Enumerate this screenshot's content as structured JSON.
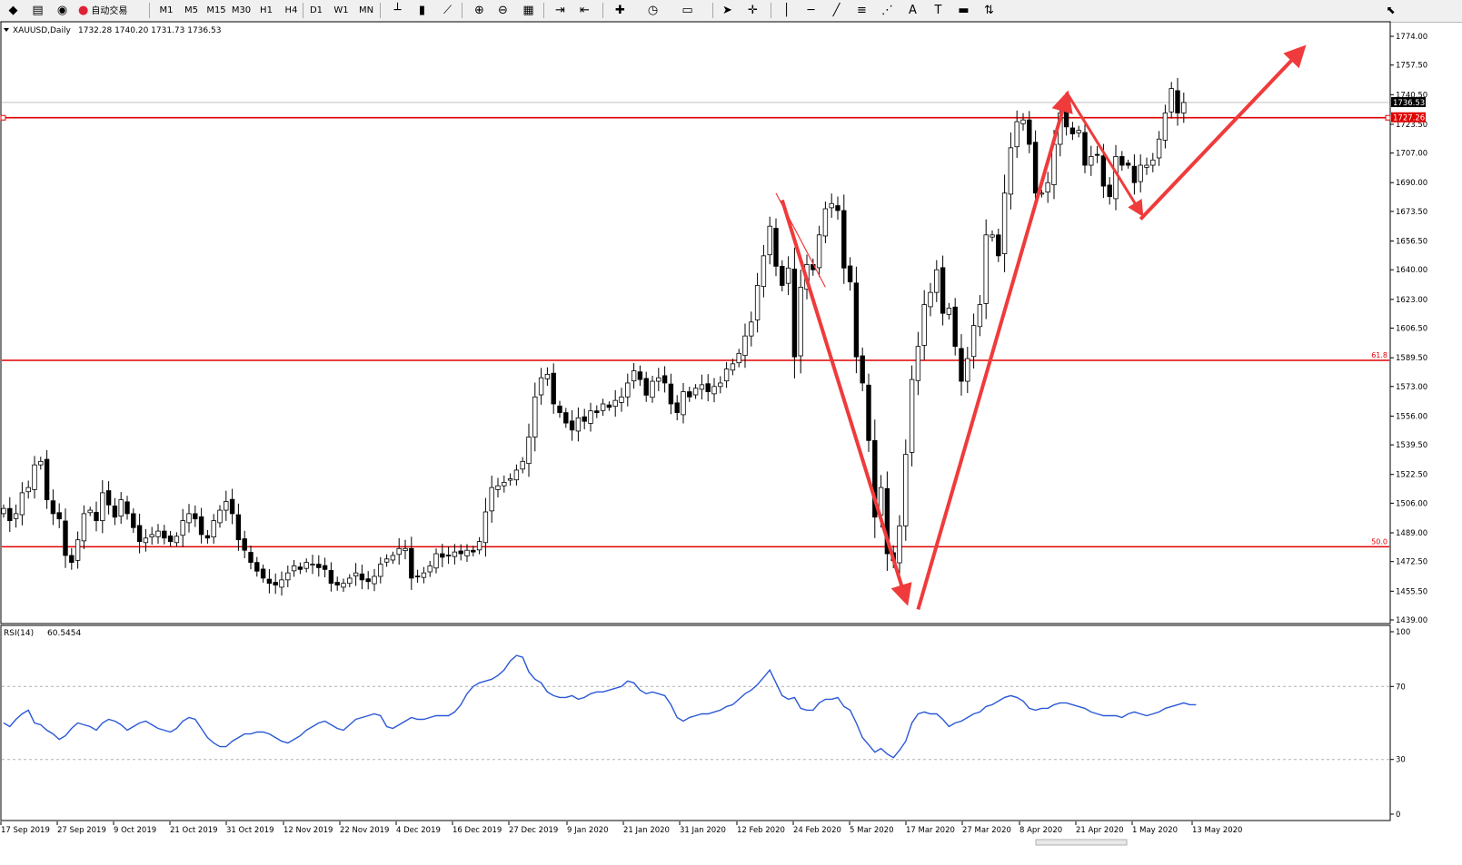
{
  "toolbar": {
    "auto_trading_label": "自动交易",
    "timeframes": [
      "M1",
      "M5",
      "M15",
      "M30",
      "H1",
      "H4",
      "D1",
      "W1",
      "MN"
    ],
    "icons": [
      "new-chart-icon",
      "profiles-icon",
      "market-watch-icon",
      "auto-trading-icon",
      "bar-chart-icon",
      "candlestick-icon",
      "line-chart-icon",
      "zoom-in-icon",
      "zoom-out-icon",
      "tile-windows-icon",
      "scroll-chart-icon",
      "chart-shift-icon",
      "indicators-icon",
      "periods-icon",
      "templates-icon",
      "cursor-icon",
      "crosshair-icon",
      "vertical-line-icon",
      "horizontal-line-icon",
      "trendline-icon",
      "equidistant-channel-icon",
      "fibonacci-icon",
      "text-icon",
      "text-label-icon",
      "rectangle-icon",
      "arrows-icon"
    ]
  },
  "colors": {
    "level_line": "#e00000",
    "arrow": "#ef3b3b",
    "rsi_line": "#2b58d6",
    "candle": "#000000",
    "price_tag_current": "#000000",
    "price_tag_level": "#e00000"
  },
  "chart_data": [
    {
      "type": "candlestick",
      "symbol_title": "XAUUSD,Daily",
      "ohlc_header": "1732.28 1740.20 1731.73 1736.53",
      "y_ticks": [
        1774.0,
        1757.5,
        1740.5,
        1723.5,
        1707.0,
        1690.0,
        1673.5,
        1656.5,
        1640.0,
        1623.0,
        1606.5,
        1589.5,
        1573.0,
        1556.0,
        1539.5,
        1522.5,
        1506.0,
        1489.0,
        1472.5,
        1455.5,
        1439.0
      ],
      "ylim": [
        1439.0,
        1774.0
      ],
      "x_labels": [
        "17 Sep 2019",
        "27 Sep 2019",
        "9 Oct 2019",
        "21 Oct 2019",
        "31 Oct 2019",
        "12 Nov 2019",
        "22 Nov 2019",
        "4 Dec 2019",
        "16 Dec 2019",
        "27 Dec 2019",
        "9 Jan 2020",
        "21 Jan 2020",
        "31 Jan 2020",
        "12 Feb 2020",
        "24 Feb 2020",
        "5 Mar 2020",
        "17 Mar 2020",
        "27 Mar 2020",
        "8 Apr 2020",
        "21 Apr 2020",
        "1 May 2020",
        "13 May 2020"
      ],
      "current_price_tag": "1736.53",
      "level_tag": "1727.26",
      "levels": [
        {
          "price": 1727.26,
          "label": ""
        },
        {
          "price": 1588.0,
          "label": "61.8"
        },
        {
          "price": 1481.0,
          "label": "50.0"
        }
      ],
      "close_series": [
        1503,
        1496,
        1500,
        1512,
        1515,
        1528,
        1530,
        1508,
        1500,
        1497,
        1476,
        1472,
        1485,
        1500,
        1502,
        1496,
        1512,
        1505,
        1498,
        1508,
        1500,
        1492,
        1484,
        1486,
        1488,
        1490,
        1486,
        1484,
        1487,
        1496,
        1500,
        1497,
        1488,
        1486,
        1496,
        1502,
        1507,
        1500,
        1485,
        1479,
        1472,
        1467,
        1463,
        1460,
        1459,
        1462,
        1466,
        1470,
        1468,
        1472,
        1471,
        1469,
        1468,
        1460,
        1459,
        1460,
        1463,
        1466,
        1462,
        1461,
        1464,
        1471,
        1474,
        1476,
        1480,
        1480,
        1463,
        1464,
        1466,
        1470,
        1477,
        1475,
        1476,
        1478,
        1477,
        1479,
        1478,
        1484,
        1501,
        1515,
        1516,
        1518,
        1520,
        1525,
        1530,
        1544,
        1567,
        1578,
        1580,
        1563,
        1558,
        1552,
        1548,
        1555,
        1553,
        1559,
        1558,
        1563,
        1561,
        1565,
        1567,
        1575,
        1582,
        1577,
        1568,
        1576,
        1578,
        1575,
        1563,
        1558,
        1570,
        1567,
        1572,
        1574,
        1570,
        1573,
        1575,
        1583,
        1586,
        1592,
        1602,
        1610,
        1631,
        1648,
        1665,
        1642,
        1631,
        1641,
        1590,
        1630,
        1643,
        1640,
        1660,
        1675,
        1678,
        1674,
        1641,
        1633,
        1590,
        1575,
        1542,
        1498,
        1515,
        1477,
        1473,
        1493,
        1534,
        1577,
        1596,
        1620,
        1627,
        1640,
        1615,
        1618,
        1596,
        1576,
        1589,
        1608,
        1620,
        1660,
        1660,
        1648,
        1684,
        1710,
        1725,
        1726,
        1712,
        1684,
        1684,
        1690,
        1712,
        1730,
        1722,
        1718,
        1720,
        1700,
        1705,
        1706,
        1688,
        1682,
        1705,
        1700,
        1700,
        1690,
        1700,
        1700,
        1703,
        1715,
        1730,
        1744,
        1730,
        1736
      ],
      "series": [
        {
          "name": "RSI(14)",
          "value_label": "60.5454",
          "y_ticks": [
            100,
            70,
            30,
            0
          ],
          "ylim": [
            0,
            100
          ],
          "values": [
            50,
            48,
            52,
            55,
            57,
            50,
            49,
            46,
            44,
            41,
            43,
            47,
            50,
            49,
            48,
            46,
            50,
            52,
            51,
            49,
            46,
            48,
            50,
            51,
            49,
            47,
            46,
            45,
            47,
            51,
            53,
            52,
            47,
            42,
            39,
            37,
            37,
            40,
            42,
            44,
            44,
            45,
            45,
            44,
            42,
            40,
            39,
            41,
            43,
            46,
            48,
            50,
            51,
            49,
            47,
            46,
            49,
            52,
            53,
            54,
            55,
            54,
            48,
            47,
            49,
            51,
            53,
            52,
            52,
            53,
            54,
            54,
            54,
            56,
            60,
            66,
            70,
            72,
            73,
            74,
            76,
            79,
            84,
            87,
            86,
            78,
            74,
            72,
            67,
            65,
            64,
            64,
            65,
            63,
            64,
            66,
            67,
            67,
            68,
            69,
            70,
            73,
            72,
            68,
            66,
            67,
            66,
            65,
            60,
            53,
            51,
            53,
            54,
            55,
            55,
            56,
            57,
            59,
            60,
            63,
            66,
            68,
            71,
            75,
            79,
            72,
            65,
            63,
            64,
            58,
            57,
            57,
            61,
            63,
            63,
            64,
            59,
            57,
            50,
            42,
            38,
            34,
            36,
            33,
            31,
            35,
            40,
            50,
            55,
            56,
            55,
            55,
            52,
            48,
            50,
            51,
            53,
            55,
            56,
            59,
            60,
            62,
            64,
            65,
            64,
            62,
            58,
            57,
            58,
            58,
            60,
            61,
            61,
            60,
            59,
            58,
            56,
            55,
            54,
            54,
            54,
            53,
            55,
            56,
            55,
            54,
            55,
            56,
            58,
            59,
            60,
            61,
            60,
            60
          ]
        }
      ]
    }
  ]
}
